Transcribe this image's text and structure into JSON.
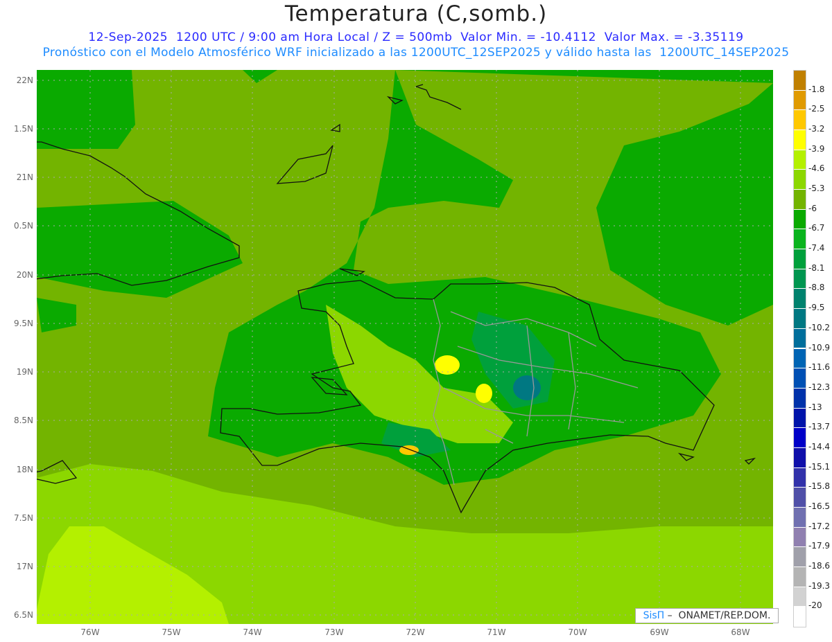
{
  "header": {
    "title": "Temperatura (C,somb.)",
    "line1": "12-Sep-2025  1200 UTC / 9:00 am Hora Local / Z = 500mb  Valor Min. = -10.4112  Valor Max. = -3.35119",
    "line2": "Pronóstico con el Modelo Atmosférico WRF inicializado a las 1200UTC_12SEP2025 y válido hasta las  1200UTC_14SEP2025"
  },
  "axes": {
    "lat_labels": [
      "22N",
      "1.5N",
      "21N",
      "0.5N",
      "20N",
      "9.5N",
      "19N",
      "8.5N",
      "18N",
      "7.5N",
      "17N",
      "6.5N"
    ],
    "lon_labels": [
      "76W",
      "75W",
      "74W",
      "73W",
      "72W",
      "71W",
      "70W",
      "69W",
      "68W"
    ]
  },
  "colorbar": {
    "labels": [
      "-1.8",
      "-2.5",
      "-3.2",
      "-3.9",
      "-4.6",
      "-5.3",
      "-6",
      "-6.7",
      "-7.4",
      "-8.1",
      "-8.8",
      "-9.5",
      "-10.2",
      "-10.9",
      "-11.6",
      "-12.3",
      "-13",
      "-13.7",
      "-14.4",
      "-15.1",
      "-15.8",
      "-16.5",
      "-17.2",
      "-17.9",
      "-18.6",
      "-19.3",
      "-20"
    ],
    "colors": [
      "#c08000",
      "#e09a00",
      "#ffc800",
      "#ffff00",
      "#b4f000",
      "#8cd700",
      "#73b400",
      "#0aaa00",
      "#0ab41e",
      "#00a03c",
      "#009650",
      "#00826e",
      "#007882",
      "#006e9b",
      "#0064b4",
      "#0050b4",
      "#0032aa",
      "#0014aa",
      "#0000c8",
      "#1010aa",
      "#3232aa",
      "#5050a8",
      "#7070b0",
      "#9080b0",
      "#a0a0aa",
      "#b4b4b4",
      "#d2d2d2",
      "#ffffff"
    ]
  },
  "logo": {
    "brand": "SisΠ",
    "text": " –  ONAMET/REP.DOM."
  }
}
